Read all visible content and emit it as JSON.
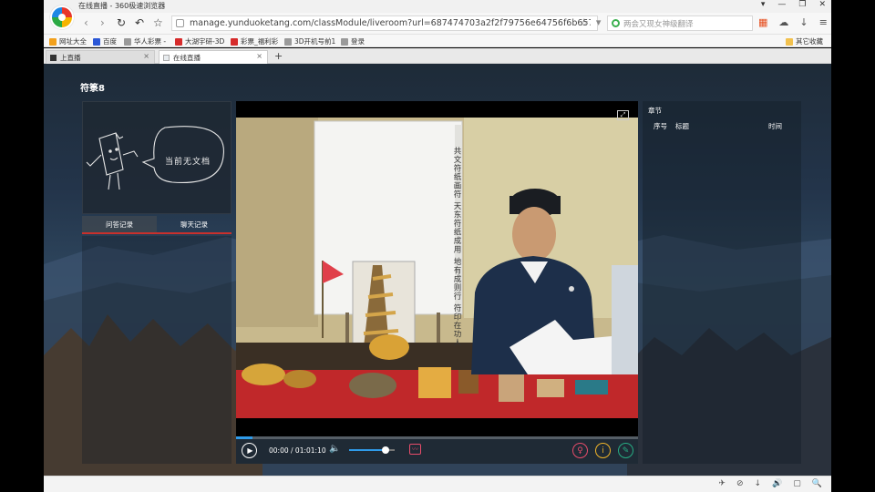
{
  "window": {
    "title": "在线直播 - 360极速浏览器",
    "controls": [
      "▾",
      "—",
      "❐",
      "✕"
    ]
  },
  "toolbar": {
    "back": "‹",
    "forward": "›",
    "reload": "↻",
    "undo": "↶",
    "star": "☆",
    "url": "manage.yunduoketang.com/classModule/liveroom?url=687474703a2f2f79756e64756f6b65746",
    "search_placeholder": "两会又现女神级翻译",
    "url_icons": [
      "☆",
      "▾"
    ],
    "right_icons": [
      "▦",
      "☁",
      "↓",
      "≡"
    ]
  },
  "bookmarks": {
    "items": [
      {
        "label": "网址大全",
        "color": "#f2a01b"
      },
      {
        "label": "百度",
        "color": "#2b57d6"
      },
      {
        "label": "华人彩票 -",
        "color": "#9a9a9a"
      },
      {
        "label": "大湖宇研-3D",
        "color": "#d62b2b"
      },
      {
        "label": "彩票_福利彩",
        "color": "#d62b2b"
      },
      {
        "label": "3D开机号前1",
        "color": "#9a9a9a"
      },
      {
        "label": "登录",
        "color": "#9a9a9a"
      }
    ],
    "other": "其它收藏"
  },
  "tabs": [
    {
      "label": "上直播",
      "active": false
    },
    {
      "label": "在线直播",
      "active": true
    }
  ],
  "newtab": "+",
  "course": {
    "title": "符箓8"
  },
  "doc": {
    "empty_text": "当前无文档"
  },
  "left_tabs": [
    {
      "label": "问答记录",
      "active": true
    },
    {
      "label": "聊天记录",
      "active": false
    }
  ],
  "video": {
    "whiteboard_lines": [
      "共文符纸画符",
      "天东符纸成用",
      "地有成则行",
      "符印在功人"
    ],
    "current_time": "00:00",
    "separator": " / ",
    "duration": "01:01:10",
    "progress": 0.04,
    "volume": 0.8,
    "expand_icon": "⤢",
    "play_icon": "▶",
    "volume_icon": "🔈",
    "stat_icon": "〰",
    "person_icon": "♀",
    "info_icon": "i",
    "pen_icon": "✎",
    "colors": {
      "person": "#e84c6a",
      "info": "#f0b429",
      "pen": "#27ae84"
    }
  },
  "directory": {
    "title": "章节",
    "columns": [
      "序号",
      "标题",
      "时间"
    ]
  },
  "statusbar": {
    "icons": [
      "✈",
      "⊘",
      "↓",
      "🔊",
      "▢",
      "🔍"
    ]
  }
}
